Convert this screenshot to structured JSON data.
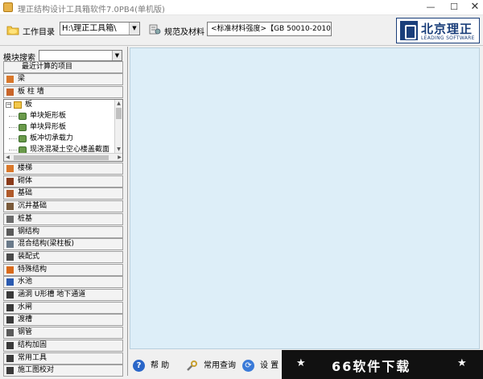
{
  "window": {
    "title": "理正结构设计工具箱软件7.0PB4(单机版)",
    "minimize": "—",
    "maximize": "☐",
    "close": "✕"
  },
  "toolbar": {
    "workdir_label": "工作目录",
    "workdir_value": "H:\\理正工具箱\\",
    "spec_label": "规范及材料",
    "spec_value": "<标准材料强度>【GB 50010-2010】"
  },
  "logo": {
    "cn": "北京理正",
    "en": "LEADING SOFTWARE"
  },
  "left_panel": {
    "search_label": "模块搜索",
    "search_value": "",
    "recent_label": "最近计算的项目",
    "top_modules": [
      {
        "label": "梁",
        "icon": "beam-icon",
        "color": "#d9772a"
      },
      {
        "label": "板 柱 墙",
        "icon": "slab-icon",
        "color": "#c9652a"
      }
    ],
    "tree": {
      "root": "板",
      "children": [
        "单块矩形板",
        "单块异形板",
        "板冲切承载力",
        "现浇混凝土空心楼盖截面"
      ]
    },
    "modules": [
      {
        "label": "楼梯",
        "icon": "stair-icon",
        "color": "#d9772a"
      },
      {
        "label": "砌体",
        "icon": "masonry-icon",
        "color": "#8a3a1a"
      },
      {
        "label": "基础",
        "icon": "foundation-icon",
        "color": "#b05a2a"
      },
      {
        "label": "沉井基础",
        "icon": "caisson-icon",
        "color": "#7a5a3a"
      },
      {
        "label": "桩基",
        "icon": "pile-icon",
        "color": "#6a6a6a"
      },
      {
        "label": "钢结构",
        "icon": "steel-icon",
        "color": "#5a5a5a"
      },
      {
        "label": "混合结构(梁柱板)",
        "icon": "composite-icon",
        "color": "#6a7a8a"
      },
      {
        "label": "装配式",
        "icon": "prefab-icon",
        "color": "#4a4a4a"
      },
      {
        "label": "特殊结构",
        "icon": "special-icon",
        "color": "#d96a1a"
      },
      {
        "label": "水池",
        "icon": "pool-icon",
        "color": "#2a5ab0"
      },
      {
        "label": "涵洞 U形槽 地下通道",
        "icon": "culvert-icon",
        "color": "#3a3a3a"
      },
      {
        "label": "水闸",
        "icon": "sluice-icon",
        "color": "#3a3a3a"
      },
      {
        "label": "渡槽",
        "icon": "aqueduct-icon",
        "color": "#3a3a3a"
      },
      {
        "label": "钢管",
        "icon": "pipe-icon",
        "color": "#5a5a5a"
      },
      {
        "label": "结构加固",
        "icon": "reinforce-icon",
        "color": "#3a3a3a"
      },
      {
        "label": "常用工具",
        "icon": "tools-icon",
        "color": "#3a3a3a"
      },
      {
        "label": "施工图校对",
        "icon": "drawing-check-icon",
        "color": "#3a3a3a"
      }
    ]
  },
  "bottombar": {
    "help": "帮 助",
    "query": "常用查询",
    "settings": "设 置"
  },
  "watermark": {
    "text": "66软件下载",
    "star": "★"
  },
  "colors": {
    "main_bg": "#ddeef8",
    "logo_blue": "#1a3e7a"
  }
}
